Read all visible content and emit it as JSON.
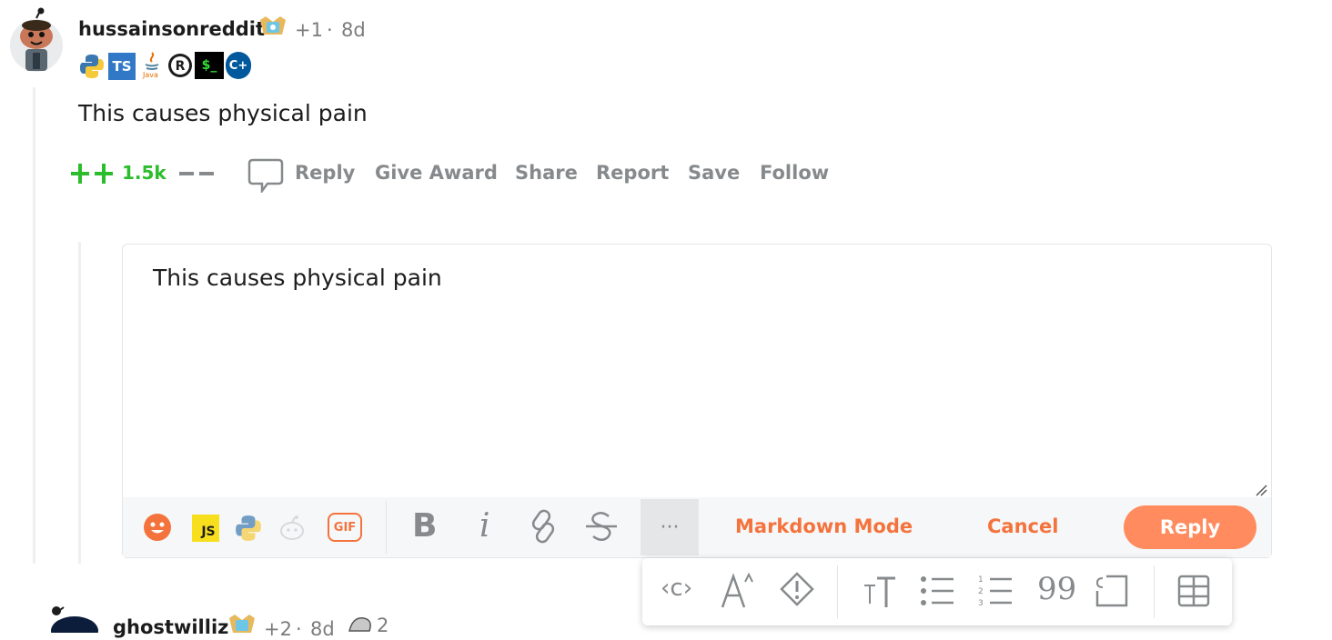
{
  "comment": {
    "username": "hussainsonreddit",
    "karma_delta": "+1",
    "separator": "·",
    "age": "8d",
    "flair_icons": [
      "python-icon",
      "typescript-icon",
      "java-icon",
      "rust-icon",
      "terminal-icon",
      "cplusplus-icon"
    ],
    "flair_ts": "TS",
    "flair_java": "Java",
    "flair_terminal": "$_",
    "flair_cpp": "C+",
    "body": "This causes physical pain",
    "vote_count": "1.5k",
    "actions": {
      "reply": "Reply",
      "give_award": "Give Award",
      "share": "Share",
      "report": "Report",
      "save": "Save",
      "follow": "Follow"
    }
  },
  "editor": {
    "text": "This causes physical pain",
    "js_label": "JS",
    "gif_label": "GIF",
    "bold_label": "B",
    "italic_label": "i",
    "more_label": "···",
    "markdown_mode": "Markdown Mode",
    "cancel": "Cancel",
    "reply": "Reply"
  },
  "format_popover": {
    "items": [
      "inline-code",
      "superscript",
      "spoiler",
      "heading",
      "bulleted-list",
      "numbered-list",
      "quote",
      "code-block",
      "table"
    ],
    "code_label": "‹c›",
    "quote_label": "99"
  },
  "next_comment": {
    "username": "ghostwilliz",
    "karma_delta": "+2",
    "separator": "·",
    "age": "8d",
    "award_count": "2"
  },
  "colors": {
    "accent": "#ff4500",
    "orange_link": "#f4733d",
    "reply_button": "#ff8b5e",
    "upvote_green": "#2bbd2b",
    "muted": "#878a8c"
  }
}
